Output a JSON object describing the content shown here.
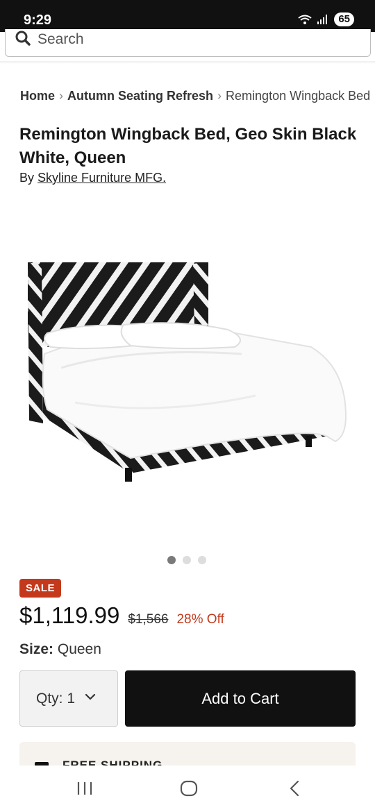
{
  "status_bar": {
    "time": "9:29",
    "battery": "65"
  },
  "search": {
    "placeholder": "Search"
  },
  "breadcrumb": {
    "home": "Home",
    "category": "Autumn Seating Refresh",
    "current": "Remington Wingback Bed"
  },
  "product": {
    "title": "Remington Wingback Bed, Geo Skin Black White, Queen",
    "by_prefix": "By",
    "brand": "Skyline Furniture MFG.",
    "sale_badge": "SALE",
    "price": "$1,119.99",
    "original_price": "$1,566",
    "discount": "28% Off",
    "size_label": "Size:",
    "size_value": "Queen",
    "image_count": 3,
    "active_image": 1
  },
  "actions": {
    "qty_label": "Qty: 1",
    "add_to_cart": "Add to Cart"
  },
  "shipping": {
    "label": "FREE SHIPPING"
  },
  "colors": {
    "sale": "#c4391b",
    "button": "#111111",
    "panel": "#f6f3ee"
  },
  "nav": {
    "recents": "recents-icon",
    "home": "home-icon",
    "back": "back-icon"
  }
}
